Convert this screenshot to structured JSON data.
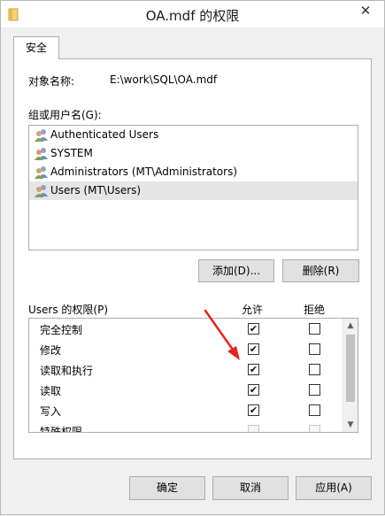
{
  "window": {
    "title": "OA.mdf 的权限",
    "close_glyph": "✕"
  },
  "tabs": [
    {
      "label": "安全",
      "selected": true
    }
  ],
  "object": {
    "label": "对象名称:",
    "value": "E:\\work\\SQL\\OA.mdf"
  },
  "group": {
    "label": "组或用户名(G):",
    "users": [
      {
        "name": "Authenticated Users",
        "selected": false
      },
      {
        "name": "SYSTEM",
        "selected": false
      },
      {
        "name": "Administrators (MT\\Administrators)",
        "selected": false
      },
      {
        "name": "Users (MT\\Users)",
        "selected": true
      }
    ],
    "add_button": "添加(D)...",
    "remove_button": "删除(R)"
  },
  "permissions": {
    "label": "Users 的权限(P)",
    "allow_header": "允许",
    "deny_header": "拒绝",
    "rows": [
      {
        "name": "完全控制",
        "allow": true,
        "deny": false
      },
      {
        "name": "修改",
        "allow": true,
        "deny": false
      },
      {
        "name": "读取和执行",
        "allow": true,
        "deny": false
      },
      {
        "name": "读取",
        "allow": true,
        "deny": false
      },
      {
        "name": "写入",
        "allow": true,
        "deny": false
      },
      {
        "name": "特殊权限",
        "allow": false,
        "deny": false,
        "disabled": true
      }
    ],
    "scroll_up_glyph": "▲",
    "scroll_down_glyph": "▼"
  },
  "footer": {
    "ok": "确定",
    "cancel": "取消",
    "apply": "应用(A)"
  },
  "colors": {
    "annotation_arrow": "#e8231c",
    "selection": "#e5e5e5"
  }
}
